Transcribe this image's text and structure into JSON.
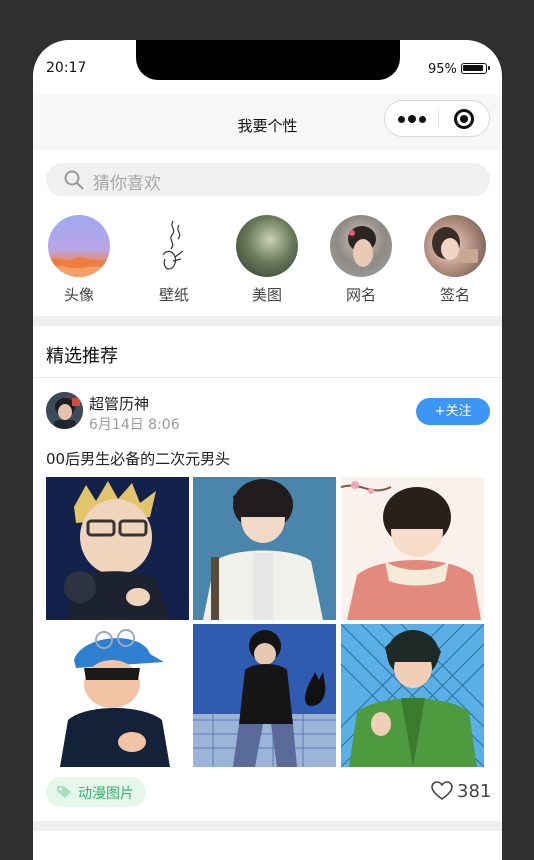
{
  "status": {
    "time": "20:17",
    "battery": "95%"
  },
  "navbar": {
    "title": "我要个性"
  },
  "search": {
    "placeholder": "猜你喜欢"
  },
  "categories": [
    {
      "label": "头像"
    },
    {
      "label": "壁纸"
    },
    {
      "label": "美图"
    },
    {
      "label": "网名"
    },
    {
      "label": "签名"
    }
  ],
  "section": {
    "title": "精选推荐"
  },
  "post": {
    "user": "超管历神",
    "date": "6月14日 8:06",
    "follow_label": "+关注",
    "text": "00后男生必备的二次元男头",
    "tag": "动漫图片",
    "likes": "381"
  },
  "colors": {
    "accent": "#3d95f5",
    "tag_text": "#36b36a",
    "tag_bg": "#e5f7ec"
  }
}
